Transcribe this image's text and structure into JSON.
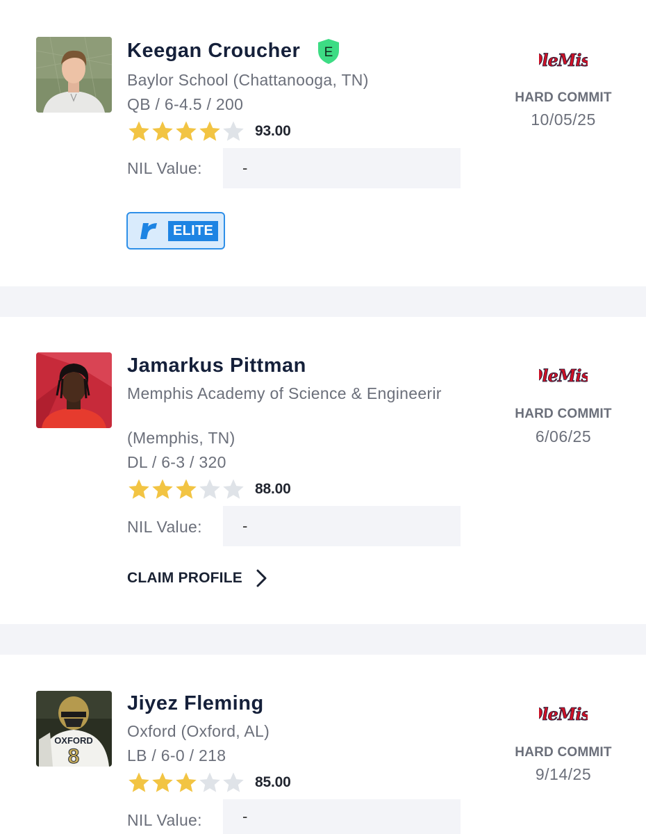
{
  "recruits": [
    {
      "name": "Keegan Croucher",
      "badge_letter": "E",
      "school": "Baylor School (Chattanooga, TN)",
      "measurables": "QB / 6-4.5 / 200",
      "stars": 4,
      "rating": "93.00",
      "nil_label": "NIL Value:",
      "nil_value": "-",
      "tag": "ELITE",
      "commit_status": "HARD COMMIT",
      "commit_date": "10/05/25",
      "college_logo": "ole-miss-logo"
    },
    {
      "name": "Jamarkus Pittman",
      "school": "Memphis Academy of Science & Engineerir",
      "school_line2": "(Memphis, TN)",
      "measurables": "DL / 6-3 / 320",
      "stars": 3,
      "rating": "88.00",
      "nil_label": "NIL Value:",
      "nil_value": "-",
      "claim_label": "CLAIM PROFILE",
      "commit_status": "HARD COMMIT",
      "commit_date": "6/06/25",
      "college_logo": "ole-miss-logo"
    },
    {
      "name": "Jiyez Fleming",
      "school": "Oxford (Oxford, AL)",
      "measurables": "LB / 6-0 / 218",
      "stars": 3,
      "rating": "85.00",
      "nil_label": "NIL Value:",
      "nil_value": "-",
      "commit_status": "HARD COMMIT",
      "commit_date": "9/14/25",
      "college_logo": "ole-miss-logo",
      "jersey_text": "OXFORD",
      "jersey_number": "8"
    }
  ],
  "colors": {
    "star_filled": "#f2c443",
    "star_empty": "#dfe3e8",
    "badge_green": "#3ddc84",
    "ole_miss_red": "#ce1126",
    "ole_miss_blue": "#14213d",
    "elite_blue": "#1d84e3"
  }
}
